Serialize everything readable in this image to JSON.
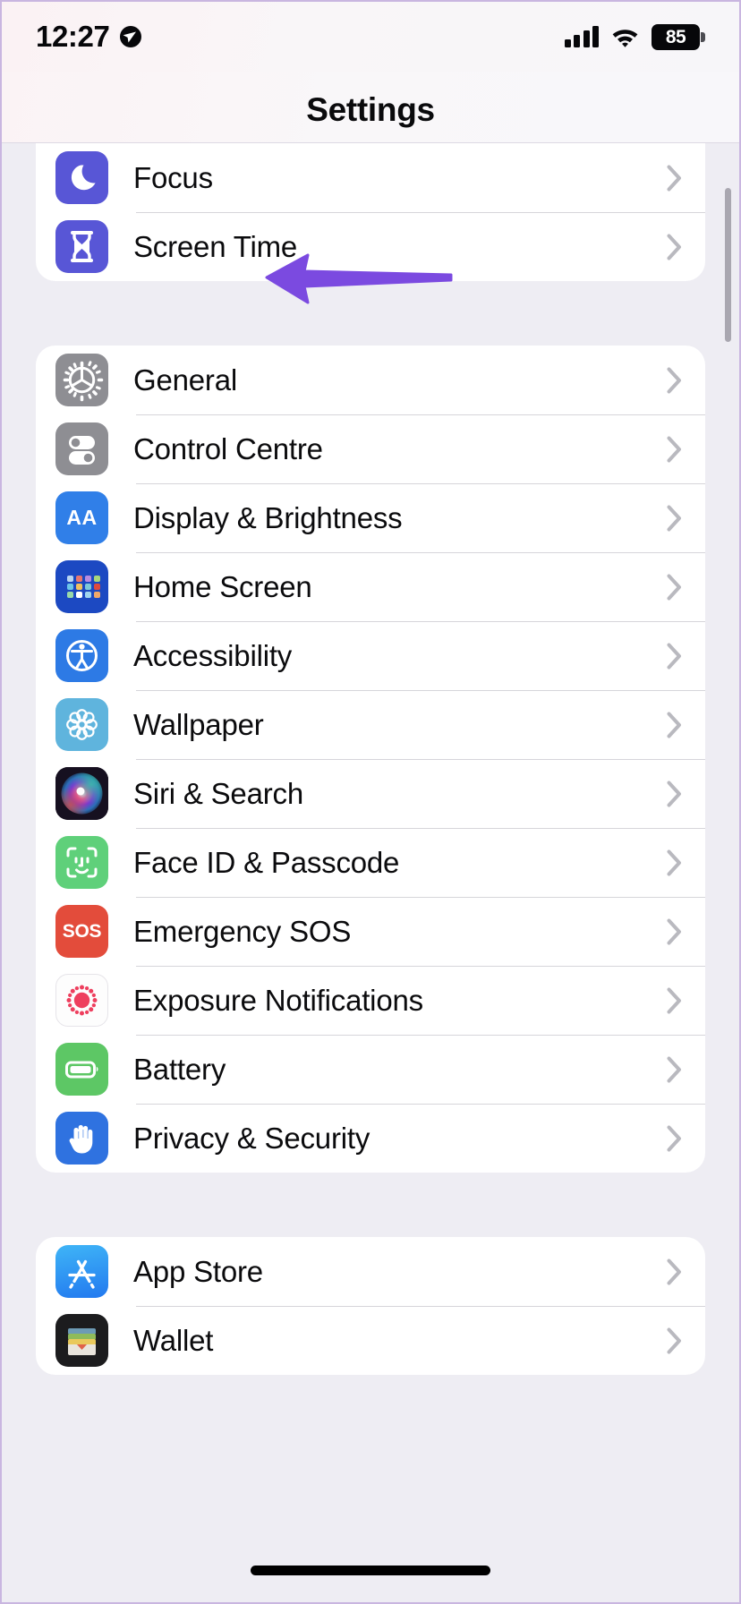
{
  "status_bar": {
    "time": "12:27",
    "location_icon": "location-arrow-icon",
    "signal_icon": "cellular-signal-icon",
    "wifi_icon": "wifi-icon",
    "battery_percent": "85"
  },
  "nav": {
    "title": "Settings"
  },
  "annotation": {
    "arrow": "purple-left-arrow",
    "color": "#7b4ae0",
    "points_to": "General"
  },
  "groups": [
    {
      "name": "focus-group",
      "rows": [
        {
          "label": "Focus",
          "icon": "moon-icon",
          "icon_bg": "#5856d6",
          "chevron": "chevron-right-icon"
        },
        {
          "label": "Screen Time",
          "icon": "hourglass-icon",
          "icon_bg": "#5856d6",
          "chevron": "chevron-right-icon"
        }
      ]
    },
    {
      "name": "system-group",
      "rows": [
        {
          "label": "General",
          "icon": "gear-icon",
          "icon_bg": "#8e8e93",
          "chevron": "chevron-right-icon"
        },
        {
          "label": "Control Centre",
          "icon": "toggles-icon",
          "icon_bg": "#8e8e93",
          "chevron": "chevron-right-icon"
        },
        {
          "label": "Display & Brightness",
          "icon": "aa-text-size-icon",
          "icon_bg": "#307fe8",
          "chevron": "chevron-right-icon"
        },
        {
          "label": "Home Screen",
          "icon": "app-grid-icon",
          "icon_bg": "#1c49c2",
          "chevron": "chevron-right-icon"
        },
        {
          "label": "Accessibility",
          "icon": "accessibility-person-icon",
          "icon_bg": "#2d7ae5",
          "chevron": "chevron-right-icon"
        },
        {
          "label": "Wallpaper",
          "icon": "flower-mandala-icon",
          "icon_bg": "#5fb4dd",
          "chevron": "chevron-right-icon"
        },
        {
          "label": "Siri & Search",
          "icon": "siri-orb-icon",
          "icon_bg": "#1a1424",
          "chevron": "chevron-right-icon"
        },
        {
          "label": "Face ID & Passcode",
          "icon": "face-id-icon",
          "icon_bg": "#5fd07a",
          "chevron": "chevron-right-icon"
        },
        {
          "label": "Emergency SOS",
          "icon": "sos-icon",
          "icon_bg": "#e34c3b",
          "chevron": "chevron-right-icon"
        },
        {
          "label": "Exposure Notifications",
          "icon": "exposure-dots-icon",
          "icon_bg": "#fdfdfd",
          "chevron": "chevron-right-icon"
        },
        {
          "label": "Battery",
          "icon": "battery-icon",
          "icon_bg": "#5dc765",
          "chevron": "chevron-right-icon"
        },
        {
          "label": "Privacy & Security",
          "icon": "hand-raised-icon",
          "icon_bg": "#2f72e0",
          "chevron": "chevron-right-icon"
        }
      ]
    },
    {
      "name": "store-group",
      "rows": [
        {
          "label": "App Store",
          "icon": "app-store-icon",
          "icon_bg": "#2a9bf5",
          "chevron": "chevron-right-icon"
        },
        {
          "label": "Wallet",
          "icon": "wallet-icon",
          "icon_bg": "#1c1c1e",
          "chevron": "chevron-right-icon"
        }
      ]
    }
  ],
  "scrollbar": {
    "name": "vertical-scrollbar"
  },
  "home_indicator": {
    "name": "home-indicator"
  }
}
